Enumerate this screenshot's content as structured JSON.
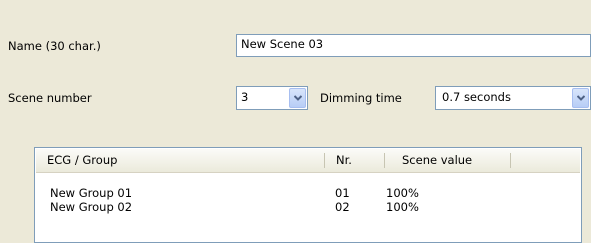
{
  "form": {
    "name_label": "Name (30 char.)",
    "name_value": "New Scene 03",
    "scene_number_label": "Scene number",
    "scene_number_value": "3",
    "dimming_time_label": "Dimming time",
    "dimming_time_value": "0.7 seconds"
  },
  "list": {
    "columns": [
      "ECG / Group",
      "Nr.",
      "Scene value"
    ],
    "rows": [
      {
        "group": "New Group 01",
        "nr": "01",
        "scene_value": "100%"
      },
      {
        "group": "New Group 02",
        "nr": "02",
        "scene_value": "100%"
      }
    ]
  },
  "icons": {
    "dropdown": "chevron-down-icon"
  },
  "colors": {
    "background": "#ece9d8",
    "field_border": "#7f9db9",
    "dropdown_button": "#b7cdf6",
    "chevron": "#4d6185"
  }
}
